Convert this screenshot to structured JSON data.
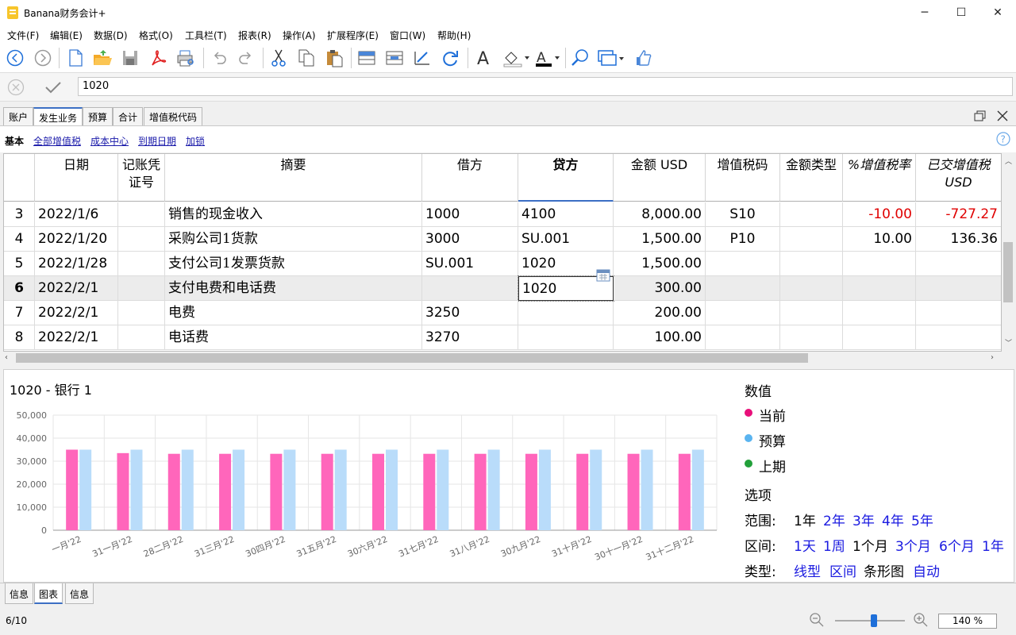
{
  "window": {
    "title": "Banana财务会计+",
    "minimize": "─",
    "maximize": "☐",
    "close": "✕"
  },
  "menu": [
    "文件(F)",
    "编辑(E)",
    "数据(D)",
    "格式(O)",
    "工具栏(T)",
    "报表(R)",
    "操作(A)",
    "扩展程序(E)",
    "窗口(W)",
    "帮助(H)"
  ],
  "formula": {
    "value": "1020"
  },
  "tabs": [
    "账户",
    "发生业务",
    "预算",
    "合计",
    "增值税代码"
  ],
  "active_tab": "发生业务",
  "views": {
    "current": "基本",
    "links": [
      "全部增值税",
      "成本中心",
      "到期日期",
      "加锁"
    ]
  },
  "columns": [
    "",
    "日期",
    "记账凭\n证号",
    "摘要",
    "借方",
    "贷方",
    "金额 USD",
    "增值税码",
    "金额类型",
    "%增值税率",
    "已交增值税\nUSD"
  ],
  "rows": [
    {
      "n": "3",
      "date": "2022/1/6",
      "doc": "",
      "desc": "销售的现金收入",
      "debit": "1000",
      "credit": "4100",
      "amount": "8,000.00",
      "vat": "S10",
      "amt_type": "",
      "rate": "-10.00",
      "vat_paid": "-727.27"
    },
    {
      "n": "4",
      "date": "2022/1/20",
      "doc": "",
      "desc": "采购公司1货款",
      "debit": "3000",
      "credit": "SU.001",
      "amount": "1,500.00",
      "vat": "P10",
      "amt_type": "",
      "rate": "10.00",
      "vat_paid": "136.36"
    },
    {
      "n": "5",
      "date": "2022/1/28",
      "doc": "",
      "desc": "支付公司1发票货款",
      "debit": "SU.001",
      "credit": "1020",
      "amount": "1,500.00",
      "vat": "",
      "amt_type": "",
      "rate": "",
      "vat_paid": ""
    },
    {
      "n": "6",
      "date": "2022/2/1",
      "doc": "",
      "desc": "支付电费和电话费",
      "debit": "",
      "credit": "1020",
      "amount": "300.00",
      "vat": "",
      "amt_type": "",
      "rate": "",
      "vat_paid": ""
    },
    {
      "n": "7",
      "date": "2022/2/1",
      "doc": "",
      "desc": "电费",
      "debit": "3250",
      "credit": "",
      "amount": "200.00",
      "vat": "",
      "amt_type": "",
      "rate": "",
      "vat_paid": ""
    },
    {
      "n": "8",
      "date": "2022/2/1",
      "doc": "",
      "desc": "电话费",
      "debit": "3270",
      "credit": "",
      "amount": "100.00",
      "vat": "",
      "amt_type": "",
      "rate": "",
      "vat_paid": ""
    }
  ],
  "chart_data": {
    "type": "bar",
    "title": "1020 - 银行 1",
    "categories": [
      "一月'22",
      "31一月'22",
      "28二月'22",
      "31三月'22",
      "30四月'22",
      "31五月'22",
      "30六月'22",
      "31七月'22",
      "31八月'22",
      "30九月'22",
      "31十月'22",
      "30十一月'22",
      "31十二月'22"
    ],
    "series": [
      {
        "name": "当前",
        "color": "#ff66bb",
        "values": [
          35000,
          33500,
          33200,
          33200,
          33200,
          33200,
          33200,
          33200,
          33200,
          33200,
          33200,
          33200,
          33200
        ]
      },
      {
        "name": "预算",
        "color": "#b9dcfa",
        "values": [
          35000,
          35000,
          35000,
          35000,
          35000,
          35000,
          35000,
          35000,
          35000,
          35000,
          35000,
          35000,
          35000
        ]
      }
    ],
    "yticks": [
      "0",
      "10,000",
      "20,000",
      "30,000",
      "40,000",
      "50,000"
    ],
    "ylim": [
      0,
      50000
    ],
    "grid": true
  },
  "legend": {
    "heading": "数值",
    "items": [
      {
        "label": "当前",
        "color": "#e8107a"
      },
      {
        "label": "预算",
        "color": "#5ab4f0"
      },
      {
        "label": "上期",
        "color": "#22a03a"
      }
    ]
  },
  "options": {
    "heading": "选项",
    "range_label": "范围:",
    "range": [
      "1年",
      "2年",
      "3年",
      "4年",
      "5年"
    ],
    "interval_label": "区间:",
    "interval": [
      "1天",
      "1周",
      "1个月",
      "3个月",
      "6个月",
      "1年"
    ],
    "type_label": "类型:",
    "type": [
      "线型",
      "区间",
      "条形图",
      "自动"
    ]
  },
  "bottom_tabs": [
    "信息",
    "图表",
    "信息"
  ],
  "status": {
    "position": "6/10",
    "zoom": "140 %"
  }
}
